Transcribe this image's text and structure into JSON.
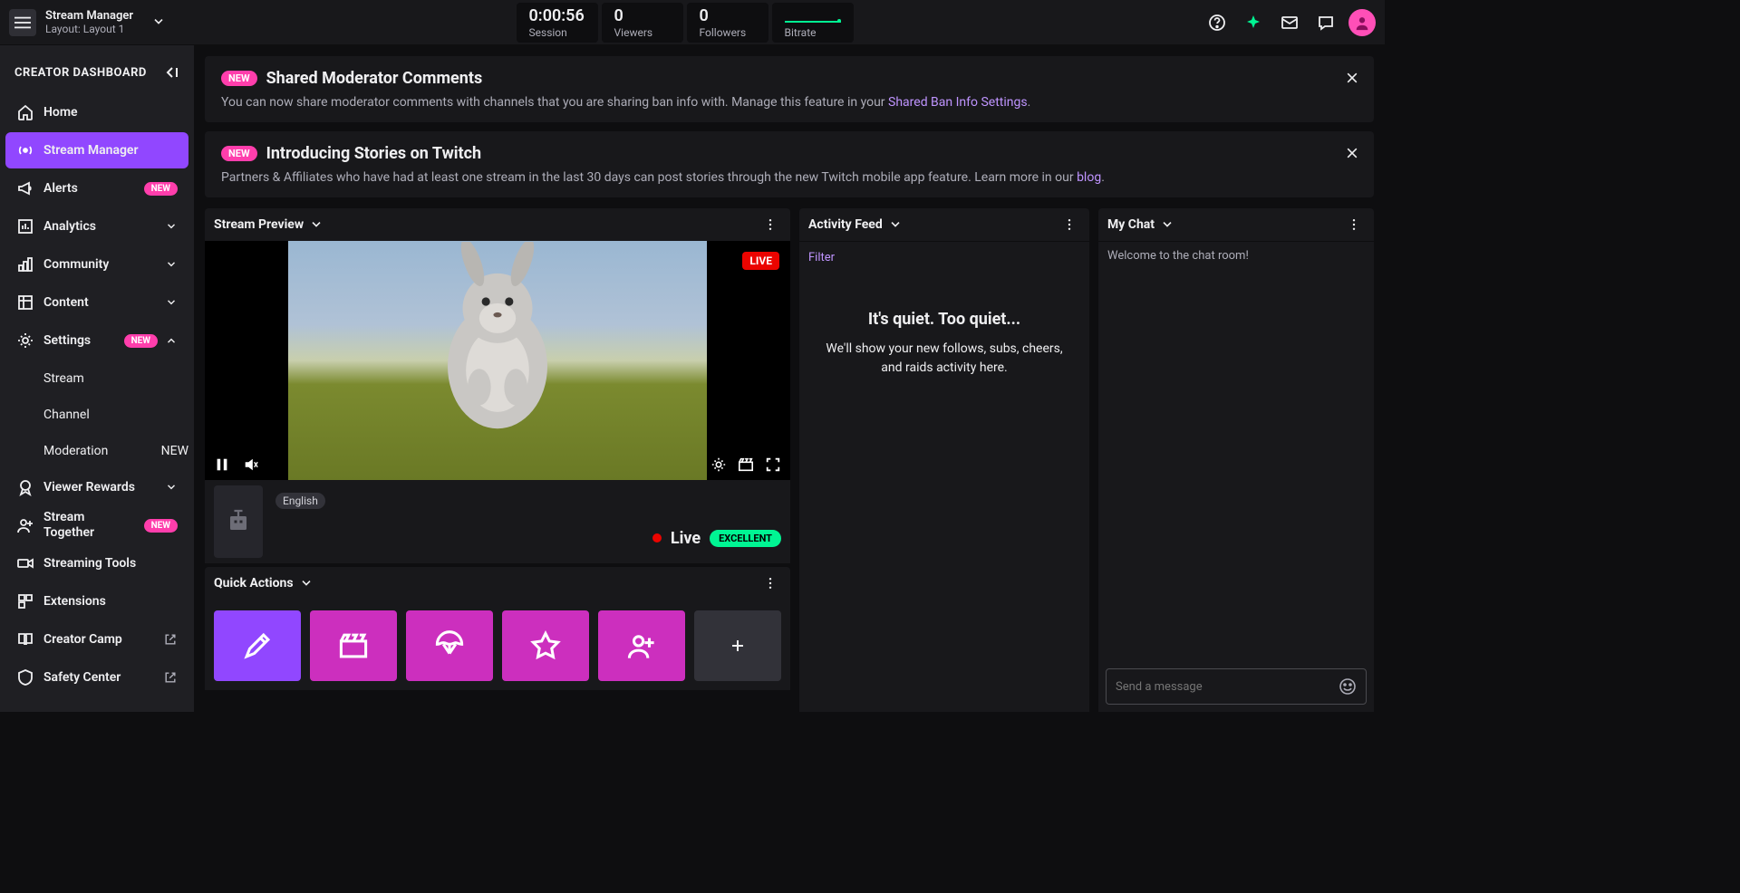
{
  "top": {
    "title": "Stream Manager",
    "layout": "Layout: Layout 1",
    "stats": {
      "session_v": "0:00:56",
      "session_l": "Session",
      "viewers_v": "0",
      "viewers_l": "Viewers",
      "followers_v": "0",
      "followers_l": "Followers",
      "bitrate_l": "Bitrate"
    }
  },
  "sidebar": {
    "header": "CREATOR DASHBOARD",
    "home": "Home",
    "stream_manager": "Stream Manager",
    "alerts": "Alerts",
    "alerts_badge": "NEW",
    "analytics": "Analytics",
    "community": "Community",
    "content": "Content",
    "settings": "Settings",
    "settings_badge": "NEW",
    "settings_stream": "Stream",
    "settings_channel": "Channel",
    "settings_moderation": "Moderation",
    "settings_moderation_badge": "NEW",
    "viewer_rewards": "Viewer Rewards",
    "stream_together": "Stream Together",
    "stream_together_badge": "NEW",
    "streaming_tools": "Streaming Tools",
    "extensions": "Extensions",
    "creator_camp": "Creator Camp",
    "safety_center": "Safety Center"
  },
  "banners": {
    "b1_new": "NEW",
    "b1_title": "Shared Moderator Comments",
    "b1_body_a": "You can now share moderator comments with channels that you are sharing ban info with. Manage this feature in your ",
    "b1_link": "Shared Ban Info Settings",
    "b1_body_b": ".",
    "b2_new": "NEW",
    "b2_title": "Introducing Stories on Twitch",
    "b2_body_a": "Partners & Affiliates who have had at least one stream in the last 30 days can post stories through the new Twitch mobile app feature. Learn more in our ",
    "b2_link": "blog",
    "b2_body_b": "."
  },
  "panels": {
    "preview_title": "Stream Preview",
    "live_badge": "LIVE",
    "language_tag": "English",
    "live_text": "Live",
    "quality_badge": "EXCELLENT",
    "quick_actions_title": "Quick Actions",
    "activity_title": "Activity Feed",
    "activity_filter": "Filter",
    "activity_empty_h": "It's quiet. Too quiet...",
    "activity_empty_d": "We'll show your new follows, subs, cheers, and raids activity here.",
    "chat_title": "My Chat",
    "chat_welcome": "Welcome to the chat room!",
    "chat_placeholder": "Send a message"
  }
}
